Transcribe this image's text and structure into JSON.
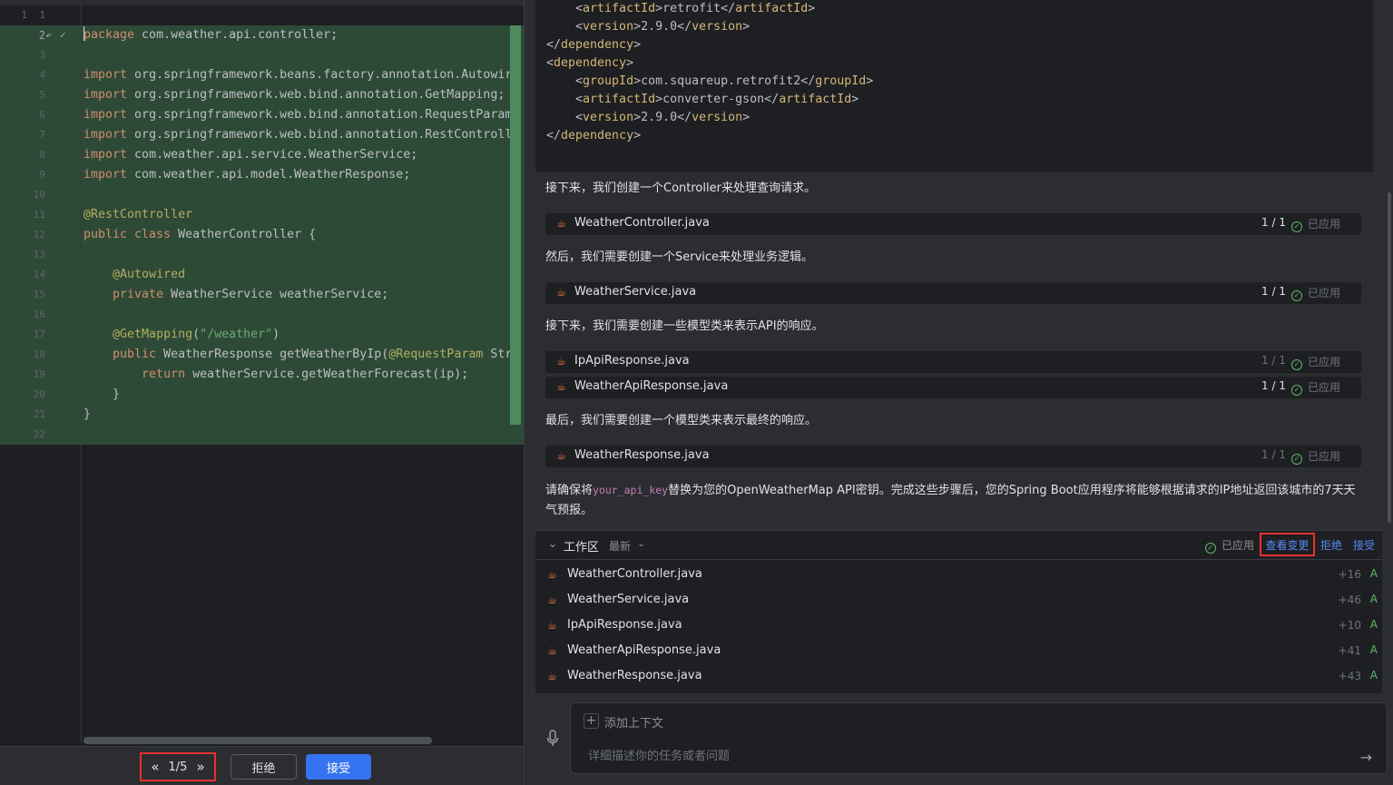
{
  "editor": {
    "lines": [
      {
        "old": "1",
        "new": "1",
        "html": ""
      },
      {
        "old": "",
        "new": "2",
        "html": "<span class=\"caret\"></span><span class=\"kw\">package</span> com.weather.api.controller;"
      },
      {
        "old": "",
        "new": "3",
        "html": ""
      },
      {
        "old": "",
        "new": "4",
        "html": "<span class=\"kw\">import</span> org.springframework.beans.factory.annotation.Autowired;"
      },
      {
        "old": "",
        "new": "5",
        "html": "<span class=\"kw\">import</span> org.springframework.web.bind.annotation.GetMapping;"
      },
      {
        "old": "",
        "new": "6",
        "html": "<span class=\"kw\">import</span> org.springframework.web.bind.annotation.RequestParam;"
      },
      {
        "old": "",
        "new": "7",
        "html": "<span class=\"kw\">import</span> org.springframework.web.bind.annotation.RestController;"
      },
      {
        "old": "",
        "new": "8",
        "html": "<span class=\"kw\">import</span> com.weather.api.service.WeatherService;"
      },
      {
        "old": "",
        "new": "9",
        "html": "<span class=\"kw\">import</span> com.weather.api.model.WeatherResponse;"
      },
      {
        "old": "",
        "new": "10",
        "html": ""
      },
      {
        "old": "",
        "new": "11",
        "html": "<span class=\"ann\">@RestController</span>"
      },
      {
        "old": "",
        "new": "12",
        "html": "<span class=\"kw\">public class</span> WeatherController {"
      },
      {
        "old": "",
        "new": "13",
        "html": ""
      },
      {
        "old": "",
        "new": "14",
        "html": "    <span class=\"ann\">@Autowired</span>"
      },
      {
        "old": "",
        "new": "15",
        "html": "    <span class=\"kw\">private</span> WeatherService weatherService;"
      },
      {
        "old": "",
        "new": "16",
        "html": ""
      },
      {
        "old": "",
        "new": "17",
        "html": "    <span class=\"ann\">@GetMapping</span>(<span class=\"str\">\"/weather\"</span>)"
      },
      {
        "old": "",
        "new": "18",
        "html": "    <span class=\"kw\">public</span> WeatherResponse getWeatherByIp(<span class=\"ann\">@RequestParam</span> String ip) {"
      },
      {
        "old": "",
        "new": "19",
        "html": "        <span class=\"kw\">return</span> weatherService.getWeatherForecast(ip);"
      },
      {
        "old": "",
        "new": "20",
        "html": "    }"
      },
      {
        "old": "",
        "new": "21",
        "html": "}"
      },
      {
        "old": "",
        "new": "22",
        "html": ""
      }
    ],
    "active_line": "2",
    "revert_icon": "undo-icon",
    "check_icon": "check-icon"
  },
  "diff_nav": {
    "position": "1/5",
    "prev_icon": "double-chevron-left-icon",
    "next_icon": "double-chevron-right-icon",
    "reject_label": "拒绝",
    "accept_label": "接受"
  },
  "xml": {
    "lines": [
      {
        "indent": 1,
        "tag": "artifactId",
        "value": "retrofit"
      },
      {
        "indent": 1,
        "tag": "version",
        "value": "2.9.0"
      },
      {
        "indent": 0,
        "close": "dependency"
      },
      {
        "indent": 0,
        "open": "dependency"
      },
      {
        "indent": 1,
        "tag": "groupId",
        "value": "com.squareup.retrofit2"
      },
      {
        "indent": 1,
        "tag": "artifactId",
        "value": "converter-gson"
      },
      {
        "indent": 1,
        "tag": "version",
        "value": "2.9.0"
      },
      {
        "indent": 0,
        "close": "dependency"
      }
    ]
  },
  "chat": {
    "msg_controller": "接下来，我们创建一个Controller来处理查询请求。",
    "msg_service": "然后，我们需要创建一个Service来处理业务逻辑。",
    "msg_models": "接下来，我们需要创建一些模型类来表示API的响应。",
    "msg_final_model": "最后，我们需要创建一个模型类来表示最终的响应。",
    "msg_closing_before": "请确保将",
    "msg_closing_code": "your_api_key",
    "msg_closing_after": "替换为您的OpenWeatherMap API密钥。完成这些步骤后，您的Spring Boot应用程序将能够根据请求的IP地址返回该城市的7天天气预报。",
    "file_cards": [
      {
        "name": "WeatherController.java",
        "count": "1 / 1",
        "dim": false,
        "status": "已应用"
      },
      {
        "name": "WeatherService.java",
        "count": "1 / 1",
        "dim": false,
        "status": "已应用"
      },
      {
        "name": "IpApiResponse.java",
        "count": "1 / 1",
        "dim": true,
        "status": "已应用"
      },
      {
        "name": "WeatherApiResponse.java",
        "count": "1 / 1",
        "dim": false,
        "status": "已应用"
      },
      {
        "name": "WeatherResponse.java",
        "count": "1 / 1",
        "dim": true,
        "status": "已应用"
      }
    ],
    "file_icon": "java-cup-icon",
    "status_icon": "check-circle-icon"
  },
  "workspace": {
    "title": "工作区",
    "filter": "最新",
    "applied": "已应用",
    "view_changes": "查看变更",
    "reject": "拒绝",
    "accept": "接受",
    "files": [
      {
        "name": "WeatherController.java",
        "plus": "+16",
        "flag": "A"
      },
      {
        "name": "WeatherService.java",
        "plus": "+46",
        "flag": "A"
      },
      {
        "name": "IpApiResponse.java",
        "plus": "+10",
        "flag": "A"
      },
      {
        "name": "WeatherApiResponse.java",
        "plus": "+41",
        "flag": "A"
      },
      {
        "name": "WeatherResponse.java",
        "plus": "+43",
        "flag": "A"
      }
    ]
  },
  "input": {
    "add_context": "添加上下文",
    "placeholder": "详细描述你的任务或者问题",
    "mic_icon": "microphone-icon",
    "send_icon": "send-arrow-icon"
  },
  "colors": {
    "editor_bg": "#1e1f22",
    "panel_bg": "#2b2d30",
    "added_bg": "#2d4a37",
    "accent": "#3574f0",
    "link": "#548af7",
    "highlight_border": "#e5312f",
    "applied_green": "#5fb865",
    "java_icon": "#e0743e"
  }
}
